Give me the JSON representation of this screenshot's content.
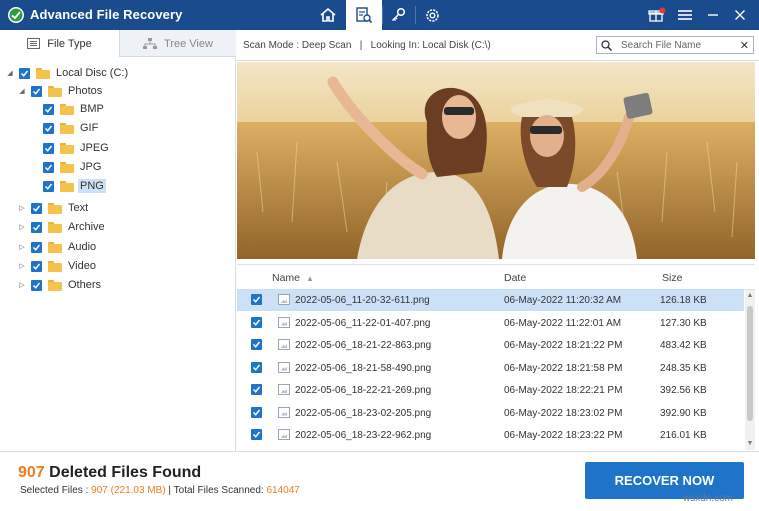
{
  "app": {
    "title": "Advanced File Recovery",
    "nav_icons": [
      "home-icon",
      "scan-results-icon",
      "key-icon",
      "gear-icon"
    ],
    "window_icons": [
      "notification-gift-icon",
      "menu-icon",
      "minimize-icon",
      "close-icon"
    ],
    "notification_count": "1"
  },
  "sidebar": {
    "tabs": [
      {
        "label": "File Type",
        "icon": "list-icon",
        "active": true
      },
      {
        "label": "Tree View",
        "icon": "tree-icon",
        "active": false
      }
    ],
    "tree": [
      {
        "label": "Local Disc (C:)",
        "level": 0,
        "expanded": true,
        "checked": true
      },
      {
        "label": "Photos",
        "level": 1,
        "expanded": true,
        "checked": true
      },
      {
        "label": "BMP",
        "level": 2,
        "checked": true
      },
      {
        "label": "GIF",
        "level": 2,
        "checked": true
      },
      {
        "label": "JPEG",
        "level": 2,
        "checked": true
      },
      {
        "label": "JPG",
        "level": 2,
        "checked": true
      },
      {
        "label": "PNG",
        "level": 2,
        "checked": true,
        "selected": true
      },
      {
        "label": "Text",
        "level": 1,
        "expanded": false,
        "checked": true
      },
      {
        "label": "Archive",
        "level": 1,
        "expanded": false,
        "checked": true
      },
      {
        "label": "Audio",
        "level": 1,
        "expanded": false,
        "checked": true
      },
      {
        "label": "Video",
        "level": 1,
        "expanded": false,
        "checked": true
      },
      {
        "label": "Others",
        "level": 1,
        "expanded": false,
        "checked": true
      }
    ]
  },
  "scanbar": {
    "text": "Scan Mode : Deep Scan   |   Looking In: Local Disk (C:\\)",
    "search_placeholder": "Search File Name"
  },
  "filelist": {
    "columns": {
      "name": "Name",
      "date": "Date",
      "size": "Size"
    },
    "rows": [
      {
        "name": "2022-05-06_11-20-32-611.png",
        "date": "06-May-2022 11:20:32 AM",
        "size": "126.18 KB",
        "selected": true
      },
      {
        "name": "2022-05-06_11-22-01-407.png",
        "date": "06-May-2022 11:22:01 AM",
        "size": "127.30 KB"
      },
      {
        "name": "2022-05-06_18-21-22-863.png",
        "date": "06-May-2022 18:21:22 PM",
        "size": "483.42 KB"
      },
      {
        "name": "2022-05-06_18-21-58-490.png",
        "date": "06-May-2022 18:21:58 PM",
        "size": "248.35 KB"
      },
      {
        "name": "2022-05-06_18-22-21-269.png",
        "date": "06-May-2022 18:22:21 PM",
        "size": "392.56 KB"
      },
      {
        "name": "2022-05-06_18-23-02-205.png",
        "date": "06-May-2022 18:23:02 PM",
        "size": "392.90 KB"
      },
      {
        "name": "2022-05-06_18-23-22-962.png",
        "date": "06-May-2022 18:23:22 PM",
        "size": "216.01 KB"
      }
    ]
  },
  "footer": {
    "found_count": "907",
    "found_label": " Deleted Files Found",
    "selected_label": "Selected Files : ",
    "selected_value": "907 (221.03 MB)",
    "total_label": " | Total Files Scanned: ",
    "total_value": "614047",
    "recover_button": "RECOVER NOW"
  },
  "watermark": "wsxdn.com",
  "colors": {
    "titlebar": "#1a4b8c",
    "accent": "#1f73c9",
    "highlight": "#f07c1f",
    "selection": "#cde1f6"
  }
}
